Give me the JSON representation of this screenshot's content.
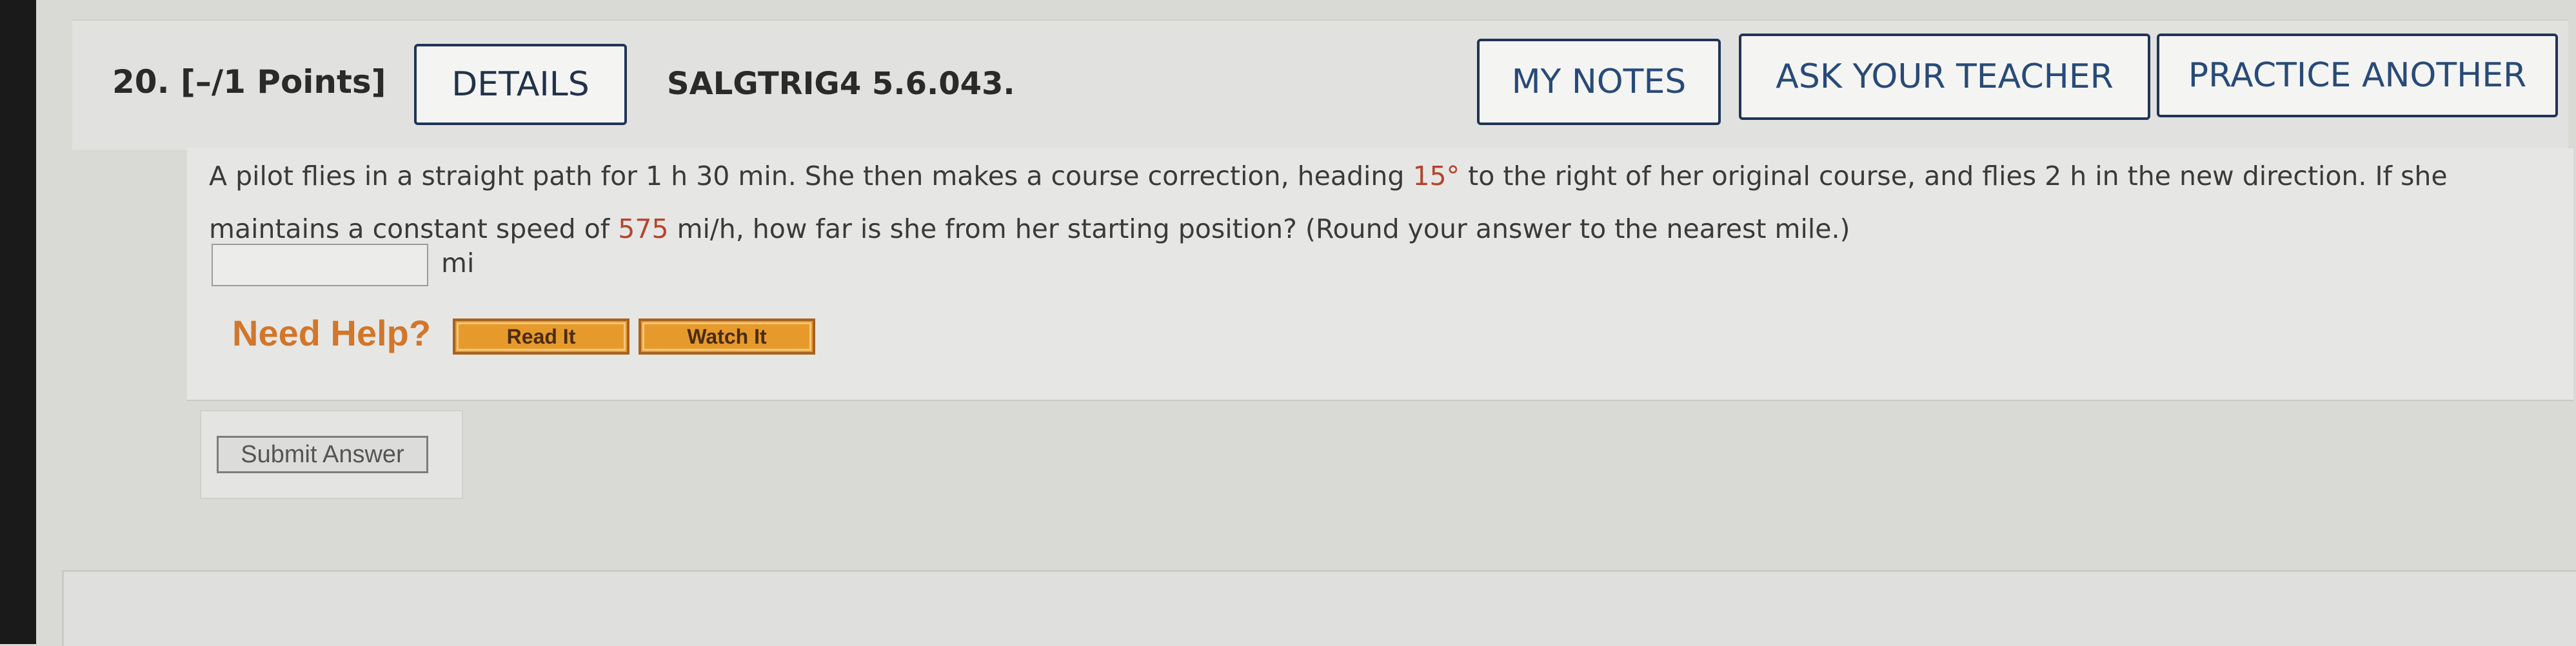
{
  "question": {
    "number_points": "20. [–/1 Points]",
    "details_label": "DETAILS",
    "reference": "SALGTRIG4 5.6.043.",
    "my_notes_label": "MY NOTES",
    "ask_teacher_label": "ASK YOUR TEACHER",
    "practice_another_label": "PRACTICE ANOTHER",
    "text_part1": "A pilot flies in a straight path for 1 h 30 min. She then makes a course correction, heading ",
    "angle": "15°",
    "text_part2": " to the right of her original course, and flies 2 h in the new direction. If she maintains a constant speed of ",
    "speed": "575",
    "text_part3": " mi/h, how far is she from her starting position? (Round your answer to the nearest mile.)",
    "answer_value": "",
    "unit": "mi"
  },
  "help": {
    "label": "Need Help?",
    "read_it": "Read It",
    "watch_it": "Watch It"
  },
  "submit_label": "Submit Answer",
  "colors": {
    "highlight": "#b5452f",
    "button_text": "#284a78",
    "help_button": "#e79a2c",
    "need_help_text": "#d2762a"
  }
}
